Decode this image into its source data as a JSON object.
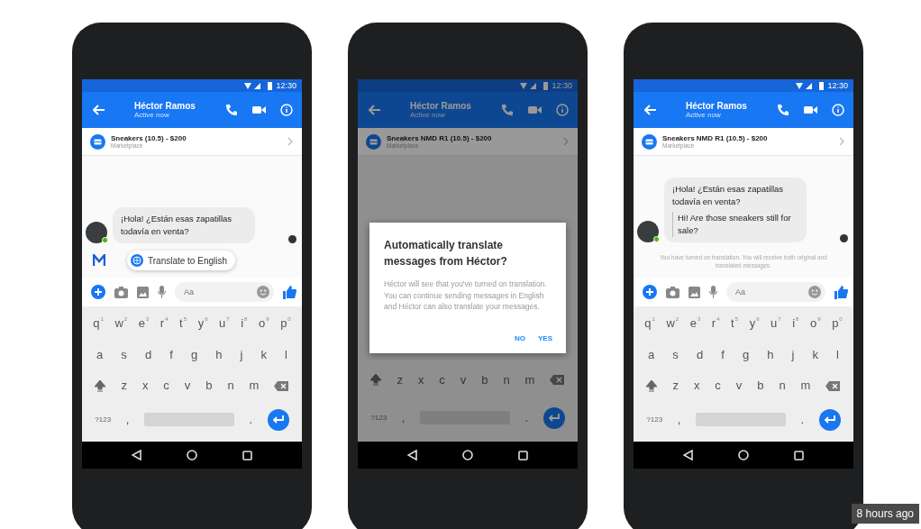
{
  "phones": [
    {
      "dimmed": false,
      "status_time": "12:30",
      "contact": {
        "name": "Héctor Ramos",
        "status": "Active now"
      },
      "listing": {
        "title": "Sneakers (10.5) - $200",
        "subtitle": "Marketplace"
      },
      "chat": [
        {
          "kind": "message",
          "text": "¡Hola! ¿Están esas zapatillas todavía en venta?"
        },
        {
          "kind": "translate_chip",
          "text": "Translate to English"
        }
      ],
      "composer": {
        "placeholder": "Aa"
      },
      "keyboard": {
        "rows": [
          {
            "kind": "plain",
            "keys": [
              {
                "key": "q",
                "hint": "1"
              },
              {
                "key": "w",
                "hint": "2"
              },
              {
                "key": "e",
                "hint": "3"
              },
              {
                "key": "r",
                "hint": "4"
              },
              {
                "key": "t",
                "hint": "5"
              },
              {
                "key": "y",
                "hint": "6"
              },
              {
                "key": "u",
                "hint": "7"
              },
              {
                "key": "i",
                "hint": "8"
              },
              {
                "key": "o",
                "hint": "9"
              },
              {
                "key": "p",
                "hint": "0"
              }
            ]
          },
          {
            "kind": "plain",
            "keys": [
              {
                "key": "a"
              },
              {
                "key": "s"
              },
              {
                "key": "d"
              },
              {
                "key": "f"
              },
              {
                "key": "g"
              },
              {
                "key": "h"
              },
              {
                "key": "j"
              },
              {
                "key": "k"
              },
              {
                "key": "l"
              }
            ]
          },
          {
            "kind": "shift",
            "keys": [
              {
                "key": "z"
              },
              {
                "key": "x"
              },
              {
                "key": "c"
              },
              {
                "key": "v"
              },
              {
                "key": "b"
              },
              {
                "key": "n"
              },
              {
                "key": "m"
              }
            ]
          }
        ],
        "symbols": "?123",
        "comma": ",",
        "period": "."
      }
    },
    {
      "dimmed": true,
      "status_time": "12:30",
      "contact": {
        "name": "Héctor Ramos",
        "status": "Active now"
      },
      "listing": {
        "title": "Sneakers NMD R1 (10.5) - $200",
        "subtitle": "Marketplace"
      },
      "dialog": {
        "title": "Automatically translate messages from Héctor?",
        "body": "Héctor will see that you've turned on translation. You can continue sending messages in English and Héctor can also translate your messages.",
        "buttons": [
          "NO",
          "YES"
        ]
      },
      "keyboard": {
        "rows": [
          {
            "kind": "shift",
            "keys": [
              {
                "key": "z"
              },
              {
                "key": "x"
              },
              {
                "key": "c"
              },
              {
                "key": "v"
              },
              {
                "key": "b"
              },
              {
                "key": "n"
              },
              {
                "key": "m"
              }
            ]
          }
        ],
        "symbols": "?123",
        "comma": ",",
        "period": "."
      }
    },
    {
      "dimmed": false,
      "status_time": "12:30",
      "contact": {
        "name": "Héctor Ramos",
        "status": "Active now"
      },
      "listing": {
        "title": "Sneakers NMD R1 (10.5) - $200",
        "subtitle": "Marketplace"
      },
      "chat": [
        {
          "kind": "message",
          "text": "¡Hola! ¿Están esas zapatillas todavía en venta?",
          "translation": "Hi! Are those sneakers still for sale?"
        },
        {
          "kind": "notice",
          "text": "You have turned on translation. You will receive both original and translated messages."
        }
      ],
      "composer": {
        "placeholder": "Aa"
      },
      "keyboard": {
        "rows": [
          {
            "kind": "plain",
            "keys": [
              {
                "key": "q",
                "hint": "1"
              },
              {
                "key": "w",
                "hint": "2"
              },
              {
                "key": "e",
                "hint": "3"
              },
              {
                "key": "r",
                "hint": "4"
              },
              {
                "key": "t",
                "hint": "5"
              },
              {
                "key": "y",
                "hint": "6"
              },
              {
                "key": "u",
                "hint": "7"
              },
              {
                "key": "i",
                "hint": "8"
              },
              {
                "key": "o",
                "hint": "9"
              },
              {
                "key": "p",
                "hint": "0"
              }
            ]
          },
          {
            "kind": "plain",
            "keys": [
              {
                "key": "a"
              },
              {
                "key": "s"
              },
              {
                "key": "d"
              },
              {
                "key": "f"
              },
              {
                "key": "g"
              },
              {
                "key": "h"
              },
              {
                "key": "j"
              },
              {
                "key": "k"
              },
              {
                "key": "l"
              }
            ]
          },
          {
            "kind": "shift",
            "keys": [
              {
                "key": "z"
              },
              {
                "key": "x"
              },
              {
                "key": "c"
              },
              {
                "key": "v"
              },
              {
                "key": "b"
              },
              {
                "key": "n"
              },
              {
                "key": "m"
              }
            ]
          }
        ],
        "symbols": "?123",
        "comma": ",",
        "period": "."
      }
    }
  ],
  "timestamp": "8 hours ago"
}
